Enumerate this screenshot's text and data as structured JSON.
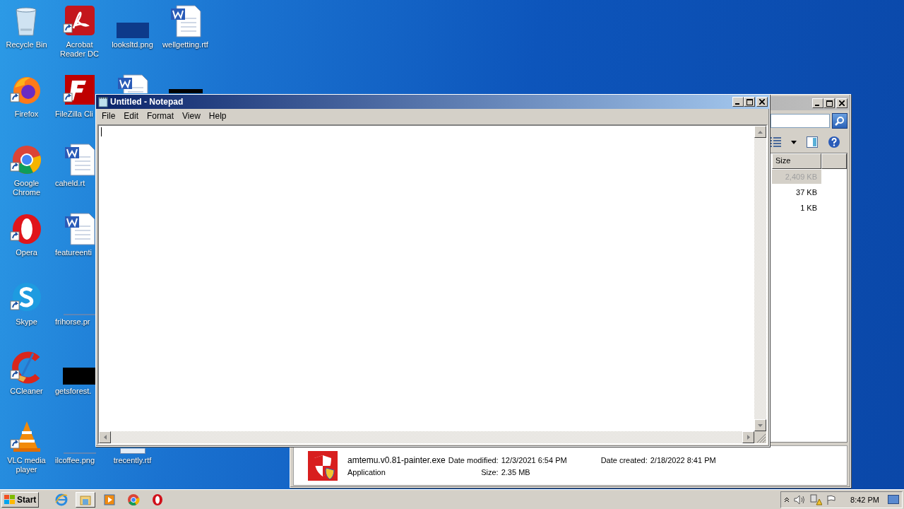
{
  "desktop": {
    "columns": [
      [
        {
          "kind": "recycle",
          "label": "Recycle Bin"
        },
        {
          "kind": "firefox",
          "label": "Firefox"
        },
        {
          "kind": "chrome",
          "label": "Google Chrome"
        },
        {
          "kind": "opera",
          "label": "Opera"
        },
        {
          "kind": "skype",
          "label": "Skype"
        },
        {
          "kind": "ccleaner",
          "label": "CCleaner"
        },
        {
          "kind": "vlc",
          "label": "VLC media player"
        }
      ],
      [
        {
          "kind": "pdf",
          "label": "Acrobat Reader DC"
        },
        {
          "kind": "filezilla",
          "label": "FileZilla Cli"
        },
        {
          "kind": "word",
          "label": "caheld.rt"
        },
        {
          "kind": "word",
          "label": "featureenti"
        },
        {
          "kind": "thin",
          "label": "frihorse.pr"
        },
        {
          "kind": "black",
          "label": "getsforest."
        },
        {
          "kind": "thin",
          "label": "ilcoffee.png"
        }
      ],
      [
        {
          "kind": "darkimage",
          "label": "looksltd.png"
        },
        {
          "kind": "partial-word"
        },
        null,
        null,
        null,
        null,
        {
          "kind": "thumb",
          "label": "trecently.rtf"
        }
      ],
      [
        {
          "kind": "word",
          "label": "wellgetting.rtf"
        },
        {
          "kind": "partial-black"
        },
        null,
        null,
        null,
        null,
        null
      ]
    ]
  },
  "explorer": {
    "columns": [
      "Size",
      ""
    ],
    "rows": [
      {
        "size": "2,409 KB",
        "selected": true
      },
      {
        "size": "37 KB",
        "selected": false
      },
      {
        "size": "1 KB",
        "selected": false
      }
    ],
    "details": {
      "name": "amtemu.v0.81-painter.exe",
      "type": "Application",
      "fields": [
        {
          "label": "Date modified:",
          "value": "12/3/2021 6:54 PM"
        },
        {
          "label": "Date created:",
          "value": "2/18/2022 8:41 PM"
        },
        {
          "label": "Size:",
          "value": "2.35 MB"
        }
      ]
    }
  },
  "notepad": {
    "title": "Untitled - Notepad",
    "menu": [
      "File",
      "Edit",
      "Format",
      "View",
      "Help"
    ]
  },
  "taskbar": {
    "start": "Start",
    "items": [
      {
        "kind": "ie",
        "selected": false
      },
      {
        "kind": "folder",
        "selected": true
      },
      {
        "kind": "media",
        "selected": false
      },
      {
        "kind": "chrome",
        "selected": false
      },
      {
        "kind": "opera",
        "selected": false
      }
    ],
    "clock": "8:42 PM"
  }
}
